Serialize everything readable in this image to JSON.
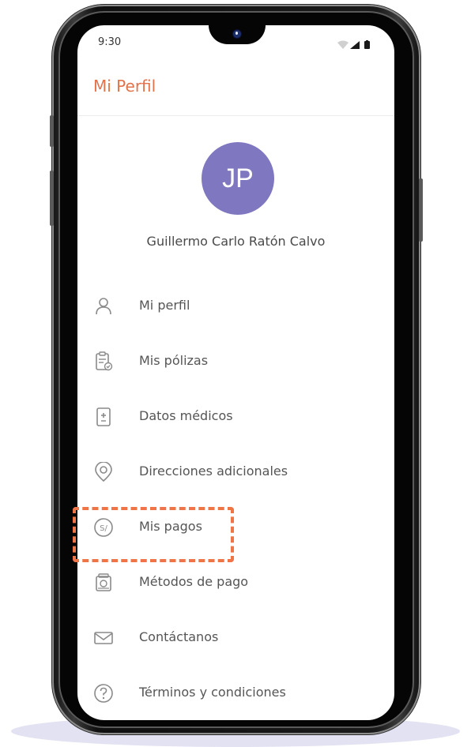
{
  "status_bar": {
    "time": "9:30"
  },
  "header": {
    "title": "Mi Perfil"
  },
  "profile": {
    "initials": "JP",
    "name": "Guillermo Carlo Ratón Calvo"
  },
  "menu": [
    {
      "label": "Mi perfil",
      "icon": "person-icon"
    },
    {
      "label": "Mis pólizas",
      "icon": "clipboard-icon"
    },
    {
      "label": "Datos médicos",
      "icon": "medical-file-icon"
    },
    {
      "label": "Direcciones adicionales",
      "icon": "location-pin-icon"
    },
    {
      "label": "Mis pagos",
      "icon": "soles-coin-icon",
      "coin_text": "S/"
    },
    {
      "label": "Métodos de pago",
      "icon": "payment-methods-icon"
    },
    {
      "label": "Contáctanos",
      "icon": "mail-icon"
    },
    {
      "label": "Términos y condiciones",
      "icon": "question-icon"
    }
  ],
  "colors": {
    "accent": "#e2734b",
    "avatar": "#7f77bf",
    "highlight": "#ef7446",
    "icon": "#8a8a8a"
  }
}
